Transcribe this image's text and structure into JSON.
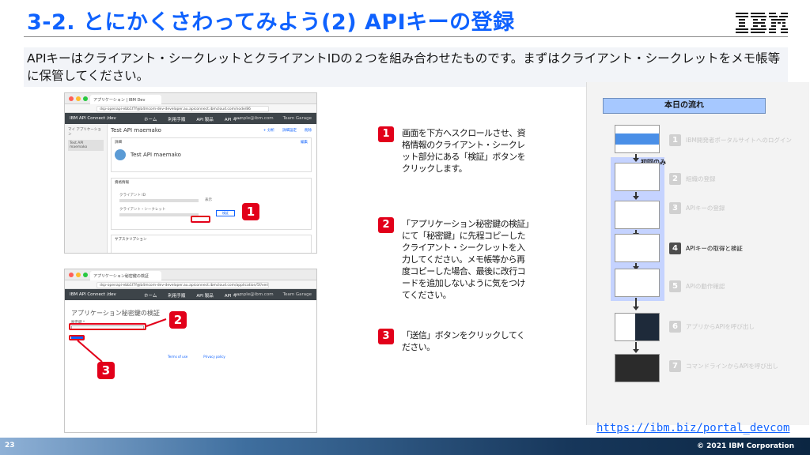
{
  "title": "3-2. とにかくさわってみよう(2) APIキーの登録",
  "logo": "IBM",
  "lead": "APIキーはクライアント・シークレットとクライアントIDの２つを組み合わせたものです。まずはクライアント・シークレットをメモ帳等に保管してください。",
  "shot1": {
    "tab": "アプリケーション | IBM Dev",
    "url": "dsp-openapi-ebb1f7f@b4mcom-dev-developer.au.apiconnect.ibmcloud.com/node/86",
    "brand": "IBM API Connect /dev",
    "nav": [
      "ホーム",
      "利用手順",
      "API 製品",
      "API キー"
    ],
    "account": [
      "sample@ibm.com",
      "Team Garage"
    ],
    "side": [
      "マイ アプリケーション",
      "Test API maemako"
    ],
    "app_title": "Test API maemako",
    "app_actions": [
      "+ 分析",
      "詳細設定",
      "削除"
    ],
    "section_detail": "詳細",
    "section_credentials": "資格情報",
    "edit_label": "編集",
    "app_name": "Test API maemako",
    "client_id_label": "クライアント ID",
    "client_secret_label": "クライアント・シークレット",
    "show_label": "表示",
    "verify_label": "検証",
    "subs_label": "サブスクリプション"
  },
  "shot2": {
    "tab": "アプリケーション秘密鍵の検証",
    "url": "dsp-openapi-ebb1f7f@b4mcom-dev-developer.au.apiconnect.ibmcloud.com/application/5f/verify",
    "brand": "IBM API Connect /dev",
    "nav": [
      "ホーム",
      "利用手順",
      "API 製品",
      "API キー"
    ],
    "account": [
      "sample@ibm.com",
      "Team Garage"
    ],
    "heading": "アプリケーション秘密鍵の検証",
    "field_label": "秘密鍵 *",
    "footer_links": [
      "Terms of use",
      "Privacy policy"
    ]
  },
  "callouts": [
    "1",
    "2",
    "3"
  ],
  "steps": [
    {
      "num": "1",
      "text": "画面を下方へスクロールさせ、資格情報のクライアント・シークレット部分にある「検証」ボタンをクリックします。"
    },
    {
      "num": "2",
      "text": "「アプリケーション秘密鍵の検証」にて「秘密鍵」に先程コピーしたクライアント・シークレットを入力してください。メモ帳等から再度コピーした場合、最後に改行コードを追加しないように気をつけてください。"
    },
    {
      "num": "3",
      "text": "「送信」ボタンをクリックしてください。"
    }
  ],
  "flow": {
    "title": "本日の流れ",
    "first_only": "初回のみ",
    "items": [
      {
        "num": "1",
        "label": "IBM開発者ポータルサイトへのログイン"
      },
      {
        "num": "2",
        "label": "組織の登録"
      },
      {
        "num": "3",
        "label": "APIキーの登録"
      },
      {
        "num": "4",
        "label": "APIキーの取得と検証"
      },
      {
        "num": "5",
        "label": "APIの動作確認"
      },
      {
        "num": "6",
        "label": "アプリからAPIを呼び出し"
      },
      {
        "num": "7",
        "label": "コマンドラインからAPIを呼び出し"
      }
    ]
  },
  "link": "https://ibm.biz/portal_devcom",
  "page_number": "23",
  "copyright": "© 2021 IBM Corporation",
  "colors": {
    "accent": "#0f62fe",
    "callout": "#e2001a",
    "flow_band": "#c5d3ff"
  }
}
